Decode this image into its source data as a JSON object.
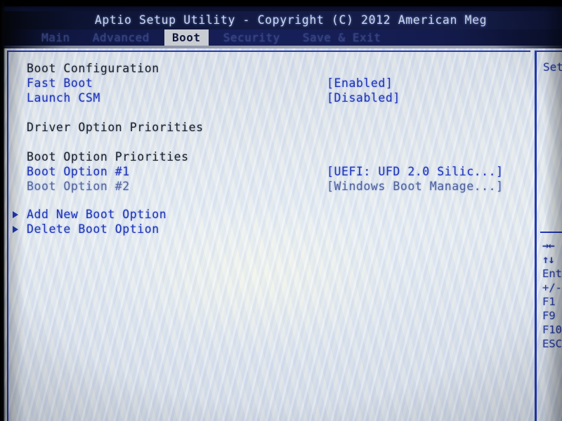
{
  "titlebar": {
    "text": "Aptio Setup Utility - Copyright (C) 2012 American Meg"
  },
  "menubar": {
    "tabs": [
      {
        "label": "Main",
        "active": false
      },
      {
        "label": "Advanced",
        "active": false
      },
      {
        "label": "Boot",
        "active": true
      },
      {
        "label": "Security",
        "active": false
      },
      {
        "label": "Save & Exit",
        "active": false
      }
    ]
  },
  "main": {
    "rows": [
      {
        "kind": "header",
        "label": "Boot Configuration",
        "value": ""
      },
      {
        "kind": "item",
        "label": "Fast Boot",
        "value": "[Enabled]"
      },
      {
        "kind": "item",
        "label": "Launch CSM",
        "value": "[Disabled]"
      },
      {
        "kind": "spacer",
        "label": "",
        "value": ""
      },
      {
        "kind": "header",
        "label": "Driver Option Priorities",
        "value": ""
      },
      {
        "kind": "spacer",
        "label": "",
        "value": ""
      },
      {
        "kind": "header",
        "label": "Boot Option Priorities",
        "value": ""
      },
      {
        "kind": "item",
        "label": "Boot Option #1",
        "value": "[UEFI: UFD 2.0 Silic...]"
      },
      {
        "kind": "item",
        "label": "Boot Option #2",
        "value": "[Windows Boot Manage...]"
      },
      {
        "kind": "spacer",
        "label": "",
        "value": ""
      },
      {
        "kind": "submenu",
        "label": "Add New Boot Option",
        "value": ""
      },
      {
        "kind": "submenu",
        "label": "Delete Boot Option",
        "value": ""
      }
    ]
  },
  "help": {
    "description": "Set",
    "keys": [
      {
        "glyph": "→←",
        "label": ""
      },
      {
        "glyph": "↑↓",
        "label": ""
      },
      {
        "glyph": "Ente",
        "label": ""
      },
      {
        "glyph": "+/-",
        "label": ""
      },
      {
        "glyph": "F1",
        "label": ""
      },
      {
        "glyph": "F9",
        "label": ""
      },
      {
        "glyph": "F10",
        "label": ""
      },
      {
        "glyph": "ESC",
        "label": ""
      }
    ]
  },
  "colors": {
    "titlebar_bg": "#141c46",
    "menubar_bg": "#17205a",
    "active_tab_bg": "#c9ccd2",
    "active_tab_fg": "#11183c",
    "body_bg": "#dfe5ee",
    "frame_blue": "#2239b4",
    "item_blue": "#2035b8",
    "header_dark": "#1b2230"
  }
}
